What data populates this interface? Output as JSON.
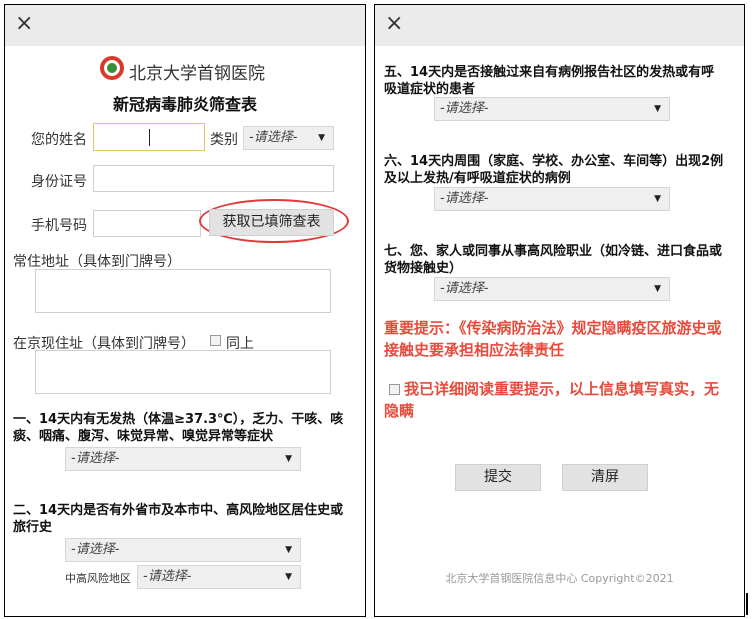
{
  "left": {
    "hospital_name": "北京大学首钢医院",
    "form_title": "新冠病毒肺炎筛查表",
    "name_label": "您的姓名",
    "category_label": "类别",
    "category_select": "-请选择-",
    "id_label": "身份证号",
    "phone_label": "手机号码",
    "fetch_button": "获取已填筛查表",
    "address_label": "常住地址（具体到门牌号）",
    "beijing_address_label": "在京现住址（具体到门牌号）",
    "same_label": "同上",
    "q1": "一、14天内有无发热（体温≥37.3℃），乏力、干咳、咳痰、咽痛、腹泻、味觉异常、嗅觉异常等症状",
    "q1_select": "-请选择-",
    "q2": "二、14天内是否有外省市及本市中、高风险地区居住史或旅行史",
    "q2_select": "-请选择-",
    "risk_area_label": "中高风险地区",
    "risk_area_select": "-请选择-"
  },
  "right": {
    "q5": "五、14天内是否接触过来自有病例报告社区的发热或有呼吸道症状的患者",
    "q5_select": "-请选择-",
    "q6": "六、14天内周围（家庭、学校、办公室、车间等）出现2例及以上发热/有呼吸道症状的病例",
    "q6_select": "-请选择-",
    "q7": "七、您、家人或同事从事高风险职业（如冷链、进口食品或货物接触史）",
    "q7_select": "-请选择-",
    "warning": "重要提示：《传染病防治法》规定隐瞒疫区旅游史或接触史要承担相应法律责任",
    "confirm": "我已详细阅读重要提示，以上信息填写真实，无隐瞒",
    "submit_button": "提交",
    "clear_button": "清屏",
    "footer": "北京大学首钢医院信息中心 Copyright©2021"
  },
  "colors": {
    "accent_red": "#e84a3c",
    "topbar": "#ebebeb"
  },
  "icons": {
    "close": "×",
    "dropdown": "▼"
  }
}
